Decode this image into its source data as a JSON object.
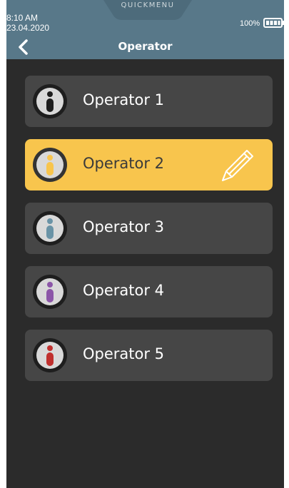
{
  "status": {
    "time": "8:10 AM",
    "date": "23.04.2020",
    "battery_percent": "100%",
    "battery_icon": "battery-full-icon",
    "quickmenu_label": "QUICKMENU"
  },
  "header": {
    "title": "Operator",
    "back_icon": "chevron-left-icon"
  },
  "operators": [
    {
      "label": "Operator 1",
      "color": "#1e1e1e",
      "selected": false
    },
    {
      "label": "Operator 2",
      "color": "#f8c54d",
      "selected": true
    },
    {
      "label": "Operator 3",
      "color": "#6a93a6",
      "selected": false
    },
    {
      "label": "Operator 4",
      "color": "#8c56a8",
      "selected": false
    },
    {
      "label": "Operator 5",
      "color": "#c0302e",
      "selected": false
    }
  ],
  "colors": {
    "header_bg": "#587889",
    "screen_bg": "#2b2b2b",
    "item_bg": "#464646",
    "selected_bg": "#f8c54d"
  },
  "icons": {
    "operator": "operator-person-icon",
    "edit": "pencil-edit-icon"
  }
}
